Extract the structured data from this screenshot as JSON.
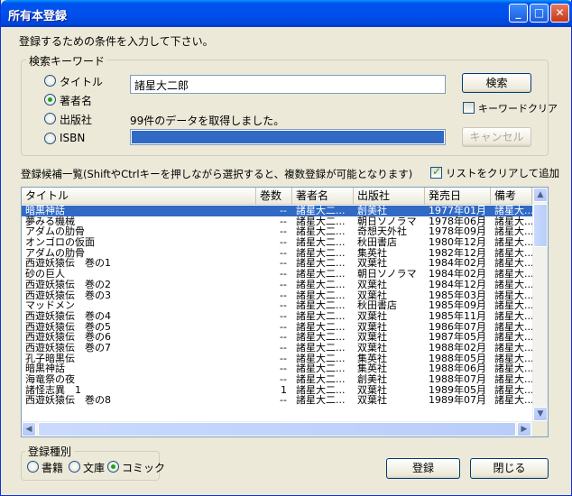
{
  "window": {
    "title": "所有本登録",
    "min_label": "_",
    "max_label": "□",
    "close_label": "✕"
  },
  "instruction": "登録するための条件を入力して下さい。",
  "search_group": {
    "legend": "検索キーワード",
    "options": [
      {
        "label": "タイトル",
        "checked": false
      },
      {
        "label": "著者名",
        "checked": true
      },
      {
        "label": "出版社",
        "checked": false
      },
      {
        "label": "ISBN",
        "checked": false
      }
    ],
    "keyword_value": "諸星大二郎",
    "status_text": "99件のデータを取得しました。",
    "progress_fraction": 1.0,
    "search_button": "検索",
    "keyword_clear_label": "キーワードクリア",
    "cancel_button": "キャンセル"
  },
  "list_caption": "登録候補一覧(ShiftやCtrlキーを押しながら選択すると、複数登録が可能となります)",
  "clear_list_label": "リストをクリアして追加",
  "table": {
    "columns": [
      "タイトル",
      "巻数",
      "著者名",
      "出版社",
      "発売日",
      "備考"
    ],
    "rows": [
      [
        "暗黒神話",
        "--",
        "諸星大二...",
        "創美社",
        "1977年01月",
        "諸星大..."
      ],
      [
        "夢みる機械",
        "--",
        "諸星大二...",
        "朝日ソノラマ",
        "1978年06月",
        "諸星大..."
      ],
      [
        "アダムの肋骨",
        "--",
        "諸星大二...",
        "奇想天外社",
        "1978年09月",
        "諸星大..."
      ],
      [
        "オンゴロの仮面",
        "--",
        "諸星大二...",
        "秋田書店",
        "1980年12月",
        "諸星大..."
      ],
      [
        "アダムの肋骨",
        "--",
        "諸星大二...",
        "集英社",
        "1982年12月",
        "諸星大..."
      ],
      [
        "西遊妖猿伝　巻の1",
        "--",
        "諸星大二...",
        "双葉社",
        "1984年02月",
        "諸星大..."
      ],
      [
        "砂の巨人",
        "--",
        "諸星大二...",
        "朝日ソノラマ",
        "1984年02月",
        "諸星大..."
      ],
      [
        "西遊妖猿伝　巻の2",
        "--",
        "諸星大二...",
        "双葉社",
        "1984年12月",
        "諸星大..."
      ],
      [
        "西遊妖猿伝　巻の3",
        "--",
        "諸星大二...",
        "双葉社",
        "1985年03月",
        "諸星大..."
      ],
      [
        "マッドメン",
        "--",
        "諸星大二...",
        "秋田書店",
        "1985年09月",
        "諸星大..."
      ],
      [
        "西遊妖猿伝　巻の4",
        "--",
        "諸星大二...",
        "双葉社",
        "1985年11月",
        "諸星大..."
      ],
      [
        "西遊妖猿伝　巻の5",
        "--",
        "諸星大二...",
        "双葉社",
        "1986年07月",
        "諸星大..."
      ],
      [
        "西遊妖猿伝　巻の6",
        "--",
        "諸星大二...",
        "双葉社",
        "1987年05月",
        "諸星大..."
      ],
      [
        "西遊妖猿伝　巻の7",
        "--",
        "諸星大二...",
        "双葉社",
        "1988年02月",
        "諸星大..."
      ],
      [
        "孔子暗黒伝",
        "--",
        "諸星大二...",
        "集英社",
        "1988年05月",
        "諸星大..."
      ],
      [
        "暗黒神話",
        "--",
        "諸星大二...",
        "集英社",
        "1988年06月",
        "諸星大..."
      ],
      [
        "海竜祭の夜",
        "--",
        "諸星大二...",
        "創美社",
        "1988年07月",
        "諸星大..."
      ],
      [
        "諸怪志異　1",
        "1",
        "諸星大二...",
        "双葉社",
        "1989年05月",
        "諸星大..."
      ],
      [
        "西遊妖猿伝　巻の8",
        "--",
        "諸星大二...",
        "双葉社",
        "1989年07月",
        "諸星大..."
      ]
    ]
  },
  "type_group": {
    "legend": "登録種別",
    "options": [
      {
        "label": "書籍",
        "checked": false
      },
      {
        "label": "文庫",
        "checked": false
      },
      {
        "label": "コミック",
        "checked": true
      }
    ]
  },
  "register_button": "登録",
  "close_button": "閉じる"
}
